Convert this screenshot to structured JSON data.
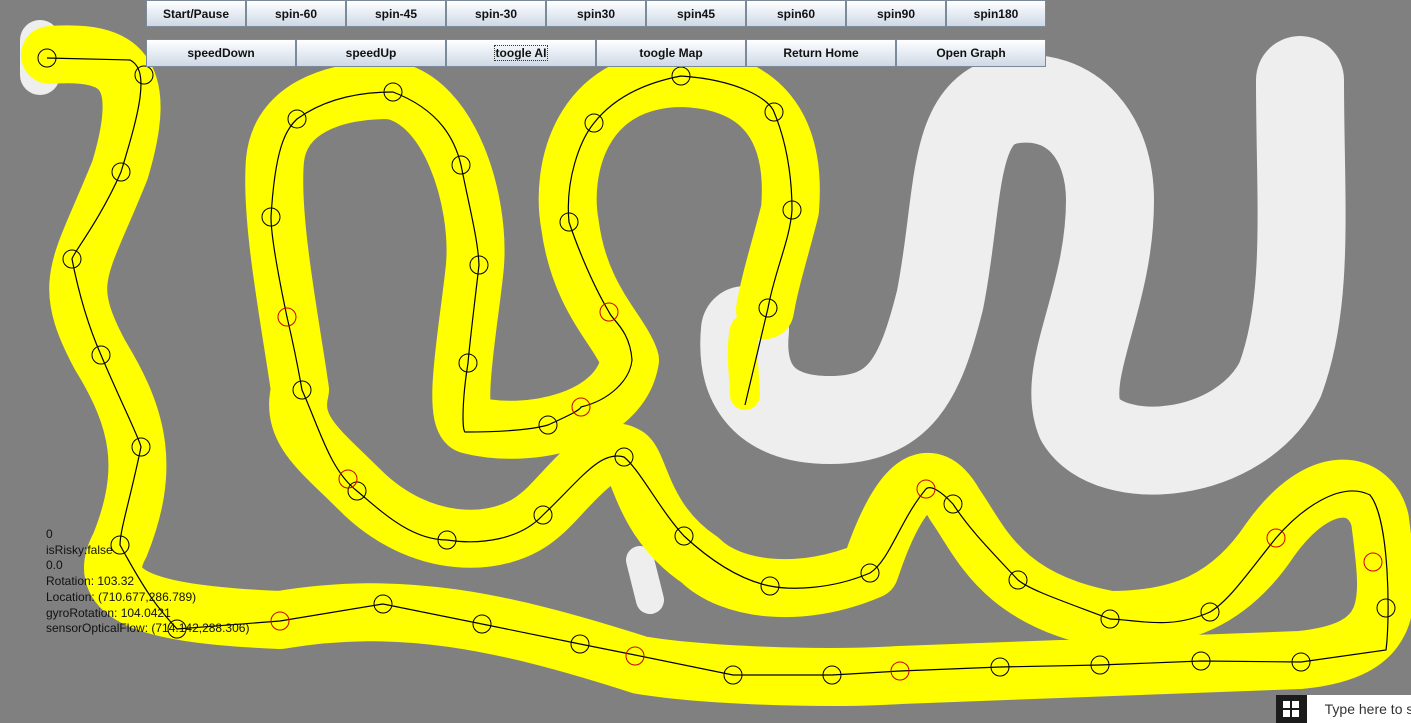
{
  "toolbar_row1": [
    "Start/Pause",
    "spin-60",
    "spin-45",
    "spin-30",
    "spin30",
    "spin45",
    "spin60",
    "spin90",
    "spin180"
  ],
  "toolbar_row2": [
    "speedDown",
    "speedUp",
    "toogle AI",
    "toogle Map",
    "Return Home",
    "Open Graph"
  ],
  "status": {
    "counter": "0",
    "risky": "isRisky:false",
    "value": "0.0",
    "rotation": "Rotation: 103.32",
    "location": "Location: (710.677,286.789)",
    "gyro": "gyroRotation: 104.0421",
    "optical": "sensorOpticalFlow: (714.142,288.306)"
  },
  "taskbar": {
    "search_placeholder": "Type here to search",
    "start_icon": "windows-logo-icon",
    "search_icon": "search-icon"
  },
  "colors": {
    "floor": "#808080",
    "explored": "#ffff00",
    "unexplored": "#eeeeee",
    "waypoint": "#000000",
    "risky_waypoint": "#cc0000"
  }
}
